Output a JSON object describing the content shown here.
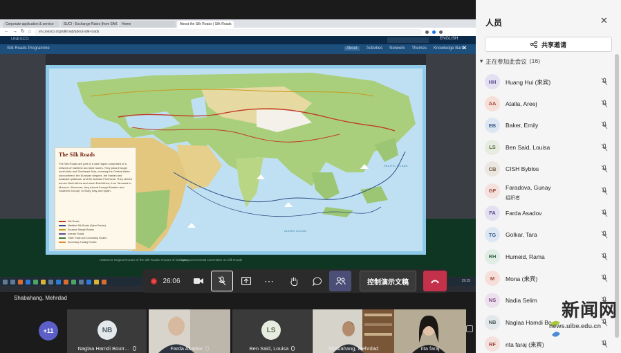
{
  "browser": {
    "tabs": [
      "Corporate application & service",
      "SUCI - Exchange Rates (from SAIC)",
      "Home",
      "About the Silk Roads | Silk Roads"
    ],
    "url": "en.unesco.org/silkroad/about-silk-roads"
  },
  "unesco_page": {
    "brand": "UNESCO",
    "lang": "ENGLISH",
    "programme": "Silk Roads Programme",
    "nav": [
      "About",
      "Activities",
      "Network",
      "Themes",
      "Knowledge Bank"
    ],
    "footer_left": "UNESCO Original Routes of the Silk Roads: Routes of Dialogue",
    "footer_mid": "Intergovernmental Committee on Silk Roads"
  },
  "map": {
    "title": "The Silk Roads",
    "description": "The Silk Roads are part of a vast region comprised of a network of maritime and land routes. They pass through south Asia and Southeast Asia, crossing the Central Asian subcontinent, the Eurasian steppes, the Iranian and Anatolian plateaus, and the Arabian Peninsula. They stretch across North Africa and reach East Africa, from Tanzania to Morocco. Moreover, they extend through Eastern and Southern Europe, to Sicily, Italy and Spain.",
    "legend": [
      {
        "label": "Silk Roads",
        "color": "#c23a26"
      },
      {
        "label": "Maritime Silk Roads (Spice Routes)",
        "color": "#2d4f86"
      },
      {
        "label": "Eurasian Steppe Routes",
        "color": "#c79b1e"
      },
      {
        "label": "Incense Roads",
        "color": "#5a4a9a"
      },
      {
        "label": "Other Trade and Connecting Routes",
        "color": "#3a7a3a"
      },
      {
        "label": "Secondary Trading Routes",
        "color": "#e08a30"
      }
    ],
    "oceans": [
      "PACIFIC OCEAN",
      "INDIAN OCEAN"
    ]
  },
  "taskbar": {
    "clock": "19:15"
  },
  "meeting": {
    "timer": "26:06",
    "present_label": "控制演示文稿",
    "presenter": "Shabahang, Mehrdad"
  },
  "strip": {
    "overflow": "+11",
    "tiles": [
      {
        "name": "Naglaa Hamdi Boutr…",
        "initials": "NB"
      },
      {
        "name": "Farda Asadov"
      },
      {
        "name": "Ben Said, Louisa",
        "initials": "LS"
      },
      {
        "name": "Shabahang, Mehrdad"
      },
      {
        "name": "rita faraj"
      }
    ]
  },
  "panel": {
    "title": "人员",
    "invite": "共享邀请",
    "section_label": "正在参加此会议",
    "section_count": "(16)",
    "participants": [
      {
        "initials": "HH",
        "name": "Huang Hui (来宾)",
        "sub": "",
        "bg": "#e4e0f1",
        "fg": "#5b4e91"
      },
      {
        "initials": "AA",
        "name": "Atalla, Areej",
        "sub": "",
        "bg": "#f6dfd8",
        "fg": "#a24a33"
      },
      {
        "initials": "EB",
        "name": "Baker, Emily",
        "sub": "",
        "bg": "#dde7f3",
        "fg": "#3a5e8a"
      },
      {
        "initials": "LS",
        "name": "Ben Said, Louisa",
        "sub": "",
        "bg": "#e6ecdf",
        "fg": "#566a43"
      },
      {
        "initials": "CB",
        "name": "CISH Byblos",
        "sub": "",
        "bg": "#ece6e1",
        "fg": "#6e5a48"
      },
      {
        "initials": "GF",
        "name": "Faradova, Gunay",
        "sub": "组织者",
        "bg": "#f4e0dc",
        "fg": "#9a4637"
      },
      {
        "initials": "FA",
        "name": "Farda Asadov",
        "sub": "",
        "bg": "#e4e0f1",
        "fg": "#5b4e91"
      },
      {
        "initials": "TG",
        "name": "Golkar, Tara",
        "sub": "",
        "bg": "#dde7f3",
        "fg": "#3a5e8a"
      },
      {
        "initials": "RH",
        "name": "Humeid, Rama",
        "sub": "",
        "bg": "#e0ede5",
        "fg": "#3f6b4e"
      },
      {
        "initials": "M",
        "name": "Mona (来宾)",
        "sub": "",
        "bg": "#f6dfd8",
        "fg": "#a24a33"
      },
      {
        "initials": "NS",
        "name": "Nadia Selim",
        "sub": "",
        "bg": "#ede0ee",
        "fg": "#7a4a7e"
      },
      {
        "initials": "NB",
        "name": "Naglaa Hamdi Bo…",
        "sub": "",
        "bg": "#e3e8ea",
        "fg": "#4a5a60"
      },
      {
        "initials": "RF",
        "name": "rita faraj (来宾)",
        "sub": "",
        "bg": "#f4e0dc",
        "fg": "#9a4637"
      }
    ]
  },
  "watermark": {
    "text": "新闻网",
    "url": "news.uibe.edu.cn"
  }
}
